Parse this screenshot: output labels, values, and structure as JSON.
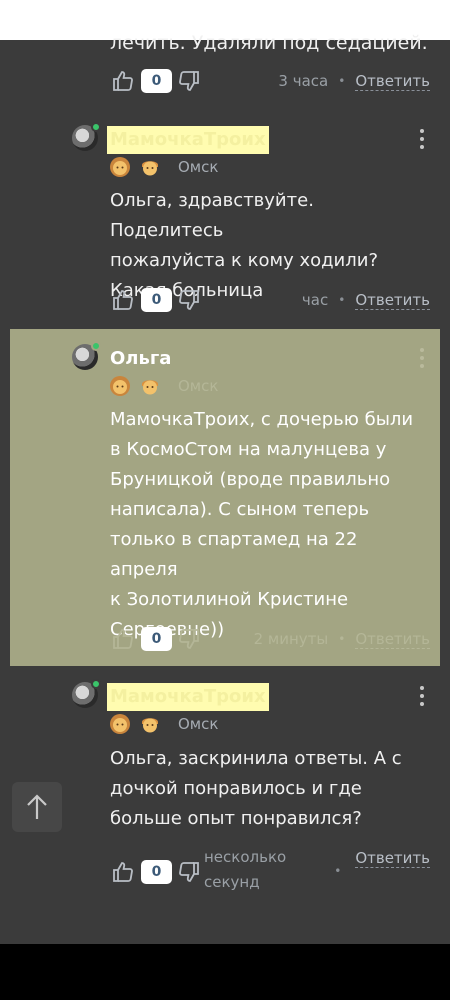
{
  "previous_comment": {
    "text_tail": "лечить. Удаляли под седацией.",
    "likes": "0",
    "time": "3 часа",
    "reply_label": "Ответить"
  },
  "comments": [
    {
      "author": "МамочкаТроих",
      "city": "Омск",
      "text_lines": [
        "Ольга, здравствуйте. Поделитесь",
        "пожалуйста к кому ходили?",
        "Какая больница"
      ],
      "likes": "0",
      "time": "час",
      "reply_label": "Ответить"
    },
    {
      "author": "Ольга",
      "city": "Омск",
      "text_lines": [
        "МамочкаТроих, с дочерью были",
        "в КосмоСтом на малунцева у",
        "Бруницкой (вроде правильно",
        "написала). С сыном теперь",
        "только в спартамед на 22 апреля",
        "к Золотилиной Кристине",
        "Сергеевне))"
      ],
      "likes": "0",
      "time": "2 минуты",
      "reply_label": "Ответить"
    },
    {
      "author": "МамочкаТроих",
      "city": "Омск",
      "text_lines": [
        "Ольга, заскринила ответы. А с",
        "дочкой понравилось и где",
        "больше опыт понравился?"
      ],
      "likes": "0",
      "time_lines": [
        "несколько",
        "секунд"
      ],
      "reply_label": "Ответить"
    }
  ],
  "colors": {
    "background": "#3b3b3b",
    "highlight_block": "#a3a583",
    "author_highlight": "#fffcb0",
    "online_dot": "#3ac46a"
  },
  "icons": {
    "like": "thumbs-up-icon",
    "dislike": "thumbs-down-icon",
    "more": "vertical-dots-icon",
    "scroll_top": "arrow-up-icon",
    "badges": [
      "girl-emoji",
      "boy-emoji"
    ]
  }
}
